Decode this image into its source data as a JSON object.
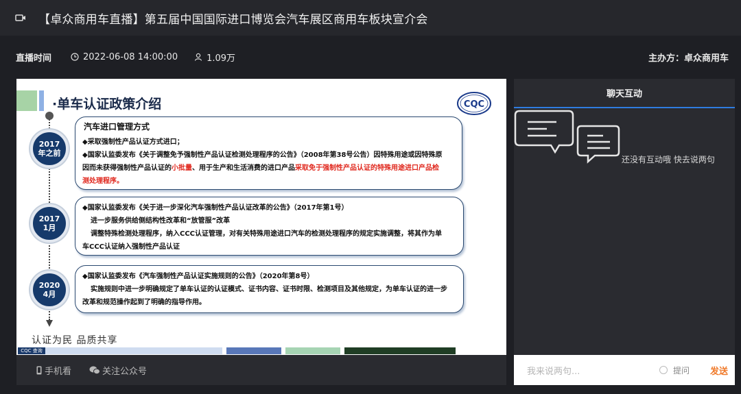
{
  "header": {
    "title": "【卓众商用车直播】第五届中国国际进口博览会汽车展区商用车板块宣介会",
    "icon": "camera-icon"
  },
  "info": {
    "time_label": "直播时间",
    "datetime": "2022-06-08 14:00:00",
    "viewers": "1.09万",
    "host": "主办方：卓众商用车"
  },
  "slide": {
    "title": "·单车认证政策介绍",
    "logo_text": "CQC",
    "years": [
      {
        "year": "2017",
        "sub": "年之前"
      },
      {
        "year": "2017",
        "sub": "1月"
      },
      {
        "year": "2020",
        "sub": "4月"
      }
    ],
    "box1": {
      "heading": "汽车进口管理方式",
      "line1": "◆采取强制性产品认证方式进口；",
      "line2a": "◆国家认监委发布《关于调整免予强制性产品认证检测处理程序的公告》（2008年第38号公告）因特殊用途或因特殊原",
      "line2b": "因而未获得强制性产品认证的",
      "line2c": "小批量",
      "line2d": "、用于生产和生活消费的进口产品",
      "line2e": "采取免于强制性产品认证的特殊用途进口产品检",
      "line2f": "测处理程序。"
    },
    "box2": {
      "line1": "◆国家认监委发布《关于进一步深化汽车强制性产品认证改革的公告》（2017年第1号）",
      "line2": "进一步服务供给侧结构性改革和“放管服”改革",
      "line3": "调整特殊检测处理程序，纳入CCC认证管理，对有关特殊用途进口汽车的检测处理程序的规定实施调整，将其作为单",
      "line4": "车CCC认证纳入强制性产品认证"
    },
    "box3": {
      "line1": "◆国家认监委发布《汽车强制性产品认证实施规则的公告》（2020年第8号）",
      "line2": "实施规则中进一步明确规定了单车认证的认证模式、证书内容、证书时限、检测项目及其他规定，为单车认证的进一步",
      "line3": "改革和规范操作起到了明确的指导作用。"
    },
    "slogan": "认证为民 品质共享",
    "tag": "CQC 查询"
  },
  "footer": {
    "phone_watch": "手机看",
    "follow": "关注公众号"
  },
  "chat": {
    "tab": "聊天互动",
    "empty": "还没有互动哦 快去说两句",
    "placeholder": "我来说两句...",
    "ask": "提问",
    "send": "发送"
  },
  "colors": {
    "accent": "#2f7de1",
    "send": "#f07a2a",
    "highlight": "#e0281e",
    "navy": "#163a6b"
  }
}
